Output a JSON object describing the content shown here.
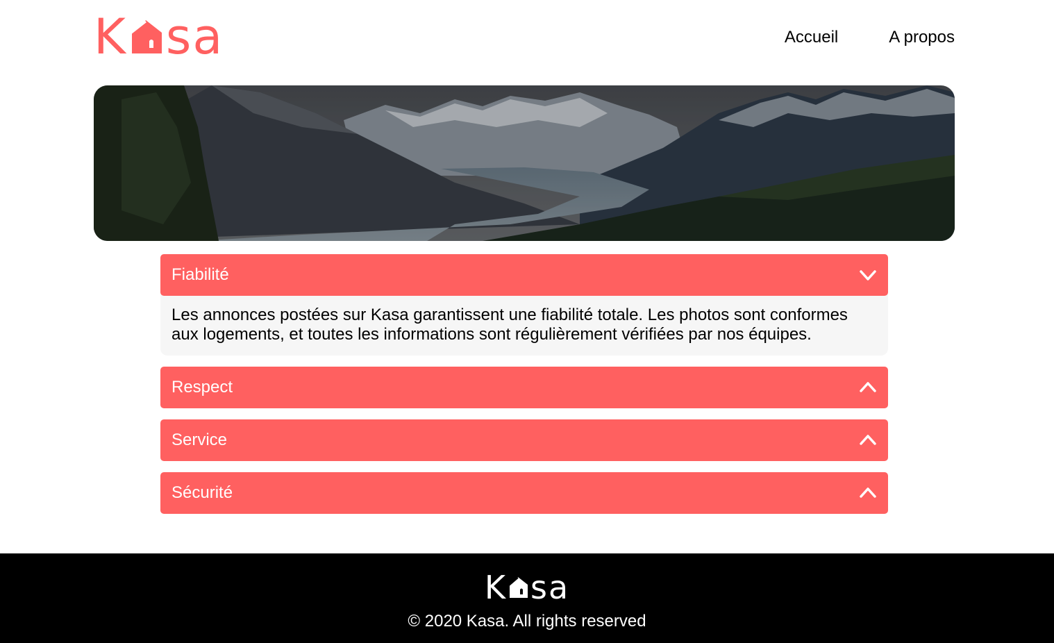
{
  "brand": {
    "logo_k": "K",
    "logo_rest": "sa",
    "accent_color": "#FF6060"
  },
  "nav": {
    "items": [
      "Accueil",
      "A propos"
    ]
  },
  "banner": {
    "image_icon": "mountain-landscape-photo"
  },
  "accordion": {
    "items": [
      {
        "title": "Fiabilité",
        "expanded": true,
        "icon": "chevron-down-icon",
        "content": "Les annonces postées sur Kasa garantissent une fiabilité totale. Les photos sont conformes aux logements, et toutes les informations sont régulièrement vérifiées par nos équipes."
      },
      {
        "title": "Respect",
        "expanded": false,
        "icon": "chevron-up-icon"
      },
      {
        "title": "Service",
        "expanded": false,
        "icon": "chevron-up-icon"
      },
      {
        "title": "Sécurité",
        "expanded": false,
        "icon": "chevron-up-icon"
      }
    ]
  },
  "footer": {
    "logo_k": "K",
    "logo_rest": "sa",
    "copyright": "© 2020 Kasa. All rights reserved"
  }
}
